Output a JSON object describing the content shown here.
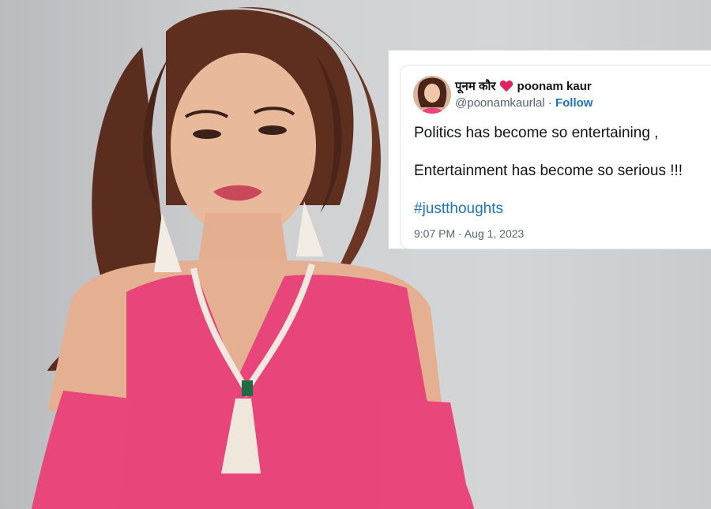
{
  "tweet": {
    "display_name": "पूनम कौर",
    "heart": "❤",
    "username": "poonam kaur",
    "handle": "@poonamkaurlal",
    "separator": " · ",
    "follow_label": "Follow",
    "lines": [
      "Politics has become so entertaining ,",
      "Entertainment has become so serious !!!"
    ],
    "hashtag": "#justthoughts",
    "timestamp": "9:07 PM · Aug 1, 2023"
  },
  "colors": {
    "link": "#1d74b8",
    "heart": "#e0245e",
    "text": "#0f1419",
    "muted": "#536471",
    "dress": "#e8457a"
  },
  "icons": {
    "heart": "heart-icon",
    "avatar": "avatar-photo"
  }
}
